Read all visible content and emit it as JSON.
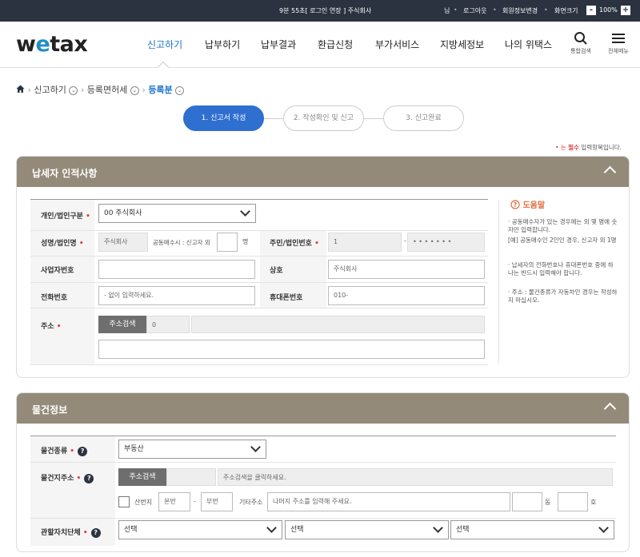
{
  "topbar": {
    "session": "9분 55초[ 로그인 연장 ] 주식회사",
    "user": "님",
    "logout": "로그아웃",
    "member_edit": "회원정보변경",
    "screen_size_label": "화면크기",
    "zoom_minus": "-",
    "zoom": "100%",
    "zoom_plus": "+"
  },
  "header": {
    "logo_w": "w",
    "logo_e": "e",
    "logo_rest": "tax",
    "nav": [
      "신고하기",
      "납부하기",
      "납부결과",
      "환급신청",
      "부가서비스",
      "지방세정보",
      "나의 위택스"
    ],
    "search_label": "통합검색",
    "menu_label": "전체메뉴"
  },
  "breadcrumb": {
    "home_icon": "home-icon",
    "items": [
      "신고하기",
      "등록면허세",
      "등록분"
    ]
  },
  "steps": [
    "1. 신고서 작성",
    "2. 작성확인 및 신고",
    "3. 신고완료"
  ],
  "required_note": {
    "prefix": "• 는 ",
    "emph": "필수",
    "suffix": " 입력항목입니다."
  },
  "taxpayer": {
    "title": "납세자 인적사항",
    "type_label": "개인/법인구분",
    "type_value": "00 주식회사",
    "name_label": "성명/법인명",
    "name_value": "주식회사",
    "joint_label": "공동매수시 : 신고자 외",
    "joint_unit": "명",
    "id_label": "주민/법인번호",
    "id_front": "1",
    "id_dash": "-",
    "id_back": "• • • • • • •",
    "biz_label": "사업자번호",
    "trade_label": "상호",
    "trade_value": "주식회사",
    "phone_label": "전화번호",
    "phone_placeholder": "- 없이 입력하세요.",
    "mobile_label": "휴대폰번호",
    "mobile_value": "010-",
    "addr_label": "주소",
    "addr_button": "주소검색",
    "addr_zip": "0"
  },
  "help": {
    "title": "도움말",
    "items": [
      "· 공동매수자가 있는 경우에는 외 몇 명에 숫자만 입력합니다.",
      "  [예] 공동매수인 2인인 경우, 신고자 외 1명",
      "· 납세자의 전화번호나 휴대폰번호 중에 하나는 반드시 입력해야 합니다.",
      "· 주소 : 물건종류가 자동차인 경우는 작성하지 마십시오."
    ]
  },
  "property": {
    "title": "물건정보",
    "kind_label": "물건종류",
    "kind_value": "부동산",
    "addr_label": "물건지주소",
    "addr_button": "주소검색",
    "addr_hint": "주소검색을 클릭하세요.",
    "mountain_label": "산번지",
    "main_no": "본번",
    "dash": "-",
    "sub_no": "부번",
    "other_addr_label": "기타주소",
    "other_addr_placeholder": "나머지 주소를 입력해 주세요.",
    "dong_unit": "동",
    "ho_unit": "호",
    "authority_label": "관할자치단체",
    "select_placeholder": "선택"
  }
}
